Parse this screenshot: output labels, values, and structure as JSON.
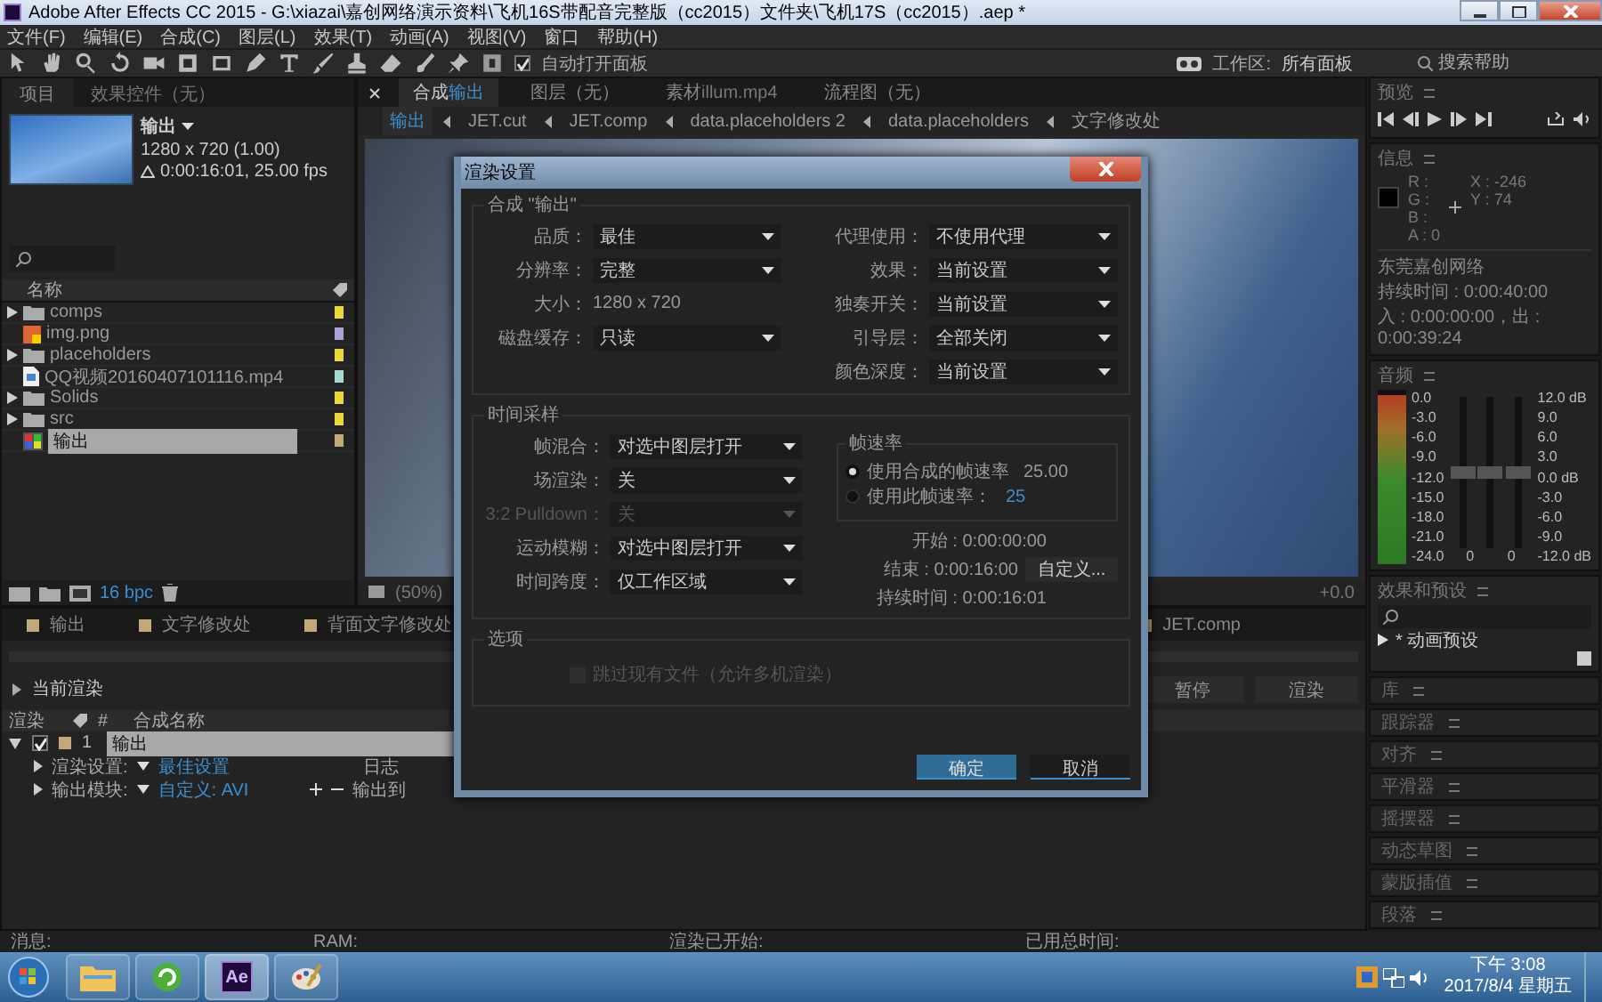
{
  "window": {
    "title": "Adobe After Effects CC 2015 - G:\\xiazai\\嘉创网络演示资料\\飞机16S带配音完整版（cc2015）文件夹\\飞机17S（cc2015）.aep *"
  },
  "menu": [
    "文件(F)",
    "编辑(E)",
    "合成(C)",
    "图层(L)",
    "效果(T)",
    "动画(A)",
    "视图(V)",
    "窗口",
    "帮助(H)"
  ],
  "toolbar": {
    "auto_open": {
      "label": "自动打开面板",
      "checked": true
    },
    "workspace": {
      "label": "工作区:",
      "value": "所有面板"
    },
    "search": {
      "placeholder": "搜索帮助"
    }
  },
  "project": {
    "tabs": [
      {
        "label": "项目",
        "selected": true
      },
      {
        "label": "效果控件（无）",
        "selected": false
      }
    ],
    "comp": {
      "name": "输出",
      "size": "1280 x 720 (1.00)",
      "duration": "0:00:16:01, 25.00 fps"
    },
    "column": "名称",
    "items": [
      {
        "kind": "folder",
        "name": "comps",
        "color": "#e8d83a",
        "selected": false
      },
      {
        "kind": "image",
        "name": "img.png",
        "color": "#a9a3d6",
        "selected": false
      },
      {
        "kind": "folder",
        "name": "placeholders",
        "color": "#e8d83a",
        "selected": false
      },
      {
        "kind": "video",
        "name": "QQ视频20160407101116.mp4",
        "color": "#a6d8d4",
        "selected": false
      },
      {
        "kind": "folder",
        "name": "Solids",
        "color": "#e8d83a",
        "selected": false
      },
      {
        "kind": "folder",
        "name": "src",
        "color": "#e8d83a",
        "selected": false
      },
      {
        "kind": "comp",
        "name": "输出",
        "color": "#c2a77a",
        "selected": true
      }
    ],
    "bpc": "16 bpc"
  },
  "viewer": {
    "tabs": [
      {
        "label": "合成",
        "value": "输出",
        "selected": true
      },
      {
        "label": "图层（无）",
        "selected": false
      },
      {
        "label": "素材",
        "value": "illum.mp4",
        "selected": false
      },
      {
        "label": "流程图（无）",
        "selected": false
      }
    ],
    "breadcrumbs": [
      {
        "label": "输出",
        "selected": true
      },
      {
        "label": "JET.cut",
        "selected": false
      },
      {
        "label": "JET.comp",
        "selected": false
      },
      {
        "label": "data.placeholders 2",
        "selected": false
      },
      {
        "label": "data.placeholders",
        "selected": false
      },
      {
        "label": "文字修改处",
        "selected": false
      }
    ],
    "zoom": "(50%)",
    "exposure": "+0.0"
  },
  "render_queue": {
    "tabs": [
      "输出",
      "文字修改处",
      "背面文字修改处",
      "JET.comp"
    ],
    "progress": {
      "level": 0
    },
    "current_render": "当前渲染",
    "buttons": [
      "暂停",
      "渲染"
    ],
    "columns": {
      "render": "渲染",
      "number": "#",
      "name": "合成名称"
    },
    "item": {
      "render": true,
      "expanded": true,
      "number": "1",
      "name": "输出",
      "settings": {
        "label": "渲染设置:",
        "value": "最佳设置",
        "log": "日志"
      },
      "output": {
        "label": "输出模块:",
        "value": "自定义: AVI",
        "target": "输出到"
      }
    }
  },
  "status_bar": [
    "消息:",
    "RAM:",
    "渲染已开始:",
    "已用总时间:"
  ],
  "taskbar": {
    "apps": [
      {
        "kind": "explorer",
        "selected": false
      },
      {
        "kind": "browser",
        "selected": false
      },
      {
        "kind": "ae",
        "label": "Ae",
        "selected": true
      },
      {
        "kind": "paint",
        "selected": false
      }
    ],
    "time": "下午 3:08",
    "date": "2017/8/4 星期五"
  },
  "preview": {
    "title": "预览"
  },
  "info": {
    "title": "信息",
    "r": "R :",
    "g": "G :",
    "b": "B :",
    "a": "A : 0",
    "x": "X : -246",
    "y": "Y : 74",
    "comp": "东莞嘉创网络",
    "duration": "持续时间 : 0:00:40:00",
    "in_out": "入 : 0:00:00:00，出 : 0:00:39:24"
  },
  "audio": {
    "title": "音频",
    "left_scale": [
      "0.0",
      "-3.0",
      "-6.0",
      "-9.0",
      "-12.0",
      "-15.0",
      "-18.0",
      "-21.0",
      "-24.0"
    ],
    "right_scale": [
      "12.0 dB",
      "9.0",
      "6.0",
      "3.0",
      "0.0 dB",
      "-3.0",
      "-6.0",
      "-9.0",
      "-12.0 dB"
    ],
    "channel_labels": [
      "0",
      "0"
    ],
    "sliders": [
      {
        "level": 0.5
      },
      {
        "level": 0.5
      },
      {
        "level": 0.5
      }
    ]
  },
  "effects": {
    "title": "效果和预设",
    "items": [
      {
        "label": "* 动画预设",
        "expanded": false
      }
    ]
  },
  "panels": [
    "库",
    "跟踪器",
    "对齐",
    "平滑器",
    "摇摆器",
    "动态草图",
    "蒙版插值",
    "段落"
  ],
  "dialog": {
    "title": "渲染设置",
    "comp_section": {
      "title": "合成 \"输出\"",
      "left": [
        {
          "kind": "dropdown",
          "label": "品质：",
          "value": "最佳"
        },
        {
          "kind": "dropdown",
          "label": "分辨率：",
          "value": "完整"
        },
        {
          "kind": "text",
          "label": "大小：",
          "value": "1280 x 720"
        },
        {
          "kind": "dropdown",
          "label": "磁盘缓存：",
          "value": "只读"
        }
      ],
      "right": [
        {
          "kind": "dropdown",
          "label": "代理使用：",
          "value": "不使用代理"
        },
        {
          "kind": "dropdown",
          "label": "效果：",
          "value": "当前设置"
        },
        {
          "kind": "dropdown",
          "label": "独奏开关：",
          "value": "当前设置"
        },
        {
          "kind": "dropdown",
          "label": "引导层：",
          "value": "全部关闭"
        },
        {
          "kind": "dropdown",
          "label": "颜色深度：",
          "value": "当前设置"
        }
      ]
    },
    "time_section": {
      "title": "时间采样",
      "fields": [
        {
          "label": "帧混合：",
          "value": "对选中图层打开",
          "disabled": false
        },
        {
          "label": "场渲染：",
          "value": "关",
          "disabled": false
        },
        {
          "label": "3:2 Pulldown：",
          "value": "关",
          "disabled": true
        },
        {
          "label": "运动模糊：",
          "value": "对选中图层打开",
          "disabled": false
        },
        {
          "label": "时间跨度：",
          "value": "仅工作区域",
          "disabled": false
        }
      ],
      "frame_rate": {
        "title": "帧速率",
        "options": [
          {
            "label": "使用合成的帧速率",
            "value": "25.00",
            "selected": true
          },
          {
            "label": "使用此帧速率：",
            "value": "25",
            "selected": false
          }
        ]
      },
      "start": "开始 : 0:00:00:00",
      "end": "结束 : 0:00:16:00",
      "custom": "自定义...",
      "duration": "持续时间 : 0:00:16:01"
    },
    "options_section": {
      "title": "选项",
      "skip": {
        "label": "跳过现有文件（允许多机渲染）",
        "checked": false,
        "disabled": true
      }
    },
    "buttons": [
      {
        "label": "确定",
        "kind": "primary"
      },
      {
        "label": "取消",
        "kind": "secondary"
      }
    ]
  }
}
